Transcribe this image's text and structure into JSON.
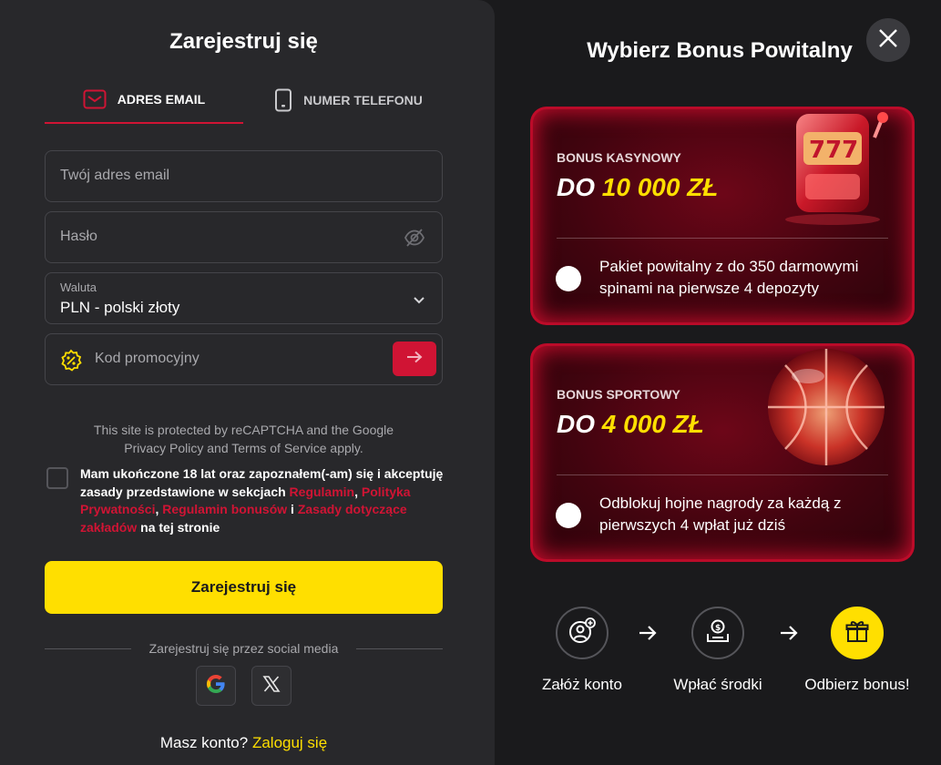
{
  "register": {
    "title": "Zarejestruj się",
    "tab_email": "ADRES EMAIL",
    "tab_phone": "NUMER TELEFONU",
    "email_placeholder": "Twój adres email",
    "password_placeholder": "Hasło",
    "currency_label": "Waluta",
    "currency_value": "PLN - polski złoty",
    "promo_placeholder": "Kod promocyjny",
    "recaptcha_line1": "This site is protected by reCAPTCHA and the Google",
    "recaptcha_line2": "Privacy Policy and Terms of Service apply.",
    "terms_text_1": "Mam ukończone 18 lat oraz zapoznałem(-am) się i akceptuję zasady przedstawione w sekcjach ",
    "terms_link_regulamin": "Regulamin",
    "terms_sep_1": ", ",
    "terms_link_privacy": "Polityka Prywatności",
    "terms_sep_2": ", ",
    "terms_link_bonus": "Regulamin bonusów",
    "terms_sep_3": " i ",
    "terms_link_bets": "Zasady dotyczące zakładów",
    "terms_text_2": " na tej stronie",
    "submit_label": "Zarejestruj się",
    "social_label": "Zarejestruj się przez social media",
    "login_prompt": "Masz konto?",
    "login_link": "Zaloguj się"
  },
  "bonus": {
    "title": "Wybierz Bonus Powitalny",
    "cards": [
      {
        "kind": "BONUS KASYNOWY",
        "amount_prefix": "DO ",
        "amount_value": "10 000 ZŁ",
        "description": "Pakiet powitalny z do 350 darmowymi spinami na pierwsze 4 depozyty",
        "art": "slot-machine-image"
      },
      {
        "kind": "BONUS SPORTOWY",
        "amount_prefix": "DO ",
        "amount_value": "4 000 ZŁ",
        "description": "Odblokuj hojne nagrody za każdą z pierwszych 4 wpłat już dziś",
        "art": "basketball-image"
      }
    ],
    "steps": [
      {
        "label": "Załóż konto",
        "icon": "user-add-icon"
      },
      {
        "label": "Wpłać środki",
        "icon": "deposit-icon"
      },
      {
        "label": "Odbierz bonus!",
        "icon": "gift-icon"
      }
    ]
  },
  "colors": {
    "accent_red": "#d01434",
    "accent_yellow": "#ffdf00",
    "panel": "#28282b",
    "bg": "#1a1a1c"
  }
}
